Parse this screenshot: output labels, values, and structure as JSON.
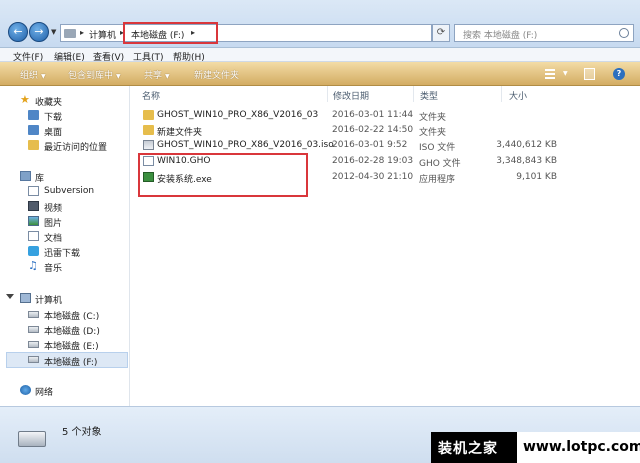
{
  "address": {
    "crumbs": [
      "计算机",
      "本地磁盘 (F:)"
    ],
    "search_placeholder": "搜索 本地磁盘 (F:)"
  },
  "menu": [
    "文件(F)",
    "编辑(E)",
    "查看(V)",
    "工具(T)",
    "帮助(H)"
  ],
  "toolbar": {
    "organize": "组织",
    "include_in_library": "包含到库中",
    "share": "共享",
    "new_folder": "新建文件夹"
  },
  "sidebar": {
    "favorites": {
      "label": "收藏夹",
      "items": [
        "下载",
        "桌面",
        "最近访问的位置"
      ]
    },
    "libraries": {
      "label": "库",
      "items": [
        "Subversion",
        "视频",
        "图片",
        "文档",
        "迅雷下载",
        "音乐"
      ]
    },
    "computer": {
      "label": "计算机",
      "items": [
        "本地磁盘 (C:)",
        "本地磁盘 (D:)",
        "本地磁盘 (E:)",
        "本地磁盘 (F:)"
      ]
    },
    "network": {
      "label": "网络"
    }
  },
  "columns": {
    "name": "名称",
    "date": "修改日期",
    "type": "类型",
    "size": "大小"
  },
  "files": [
    {
      "name": "GHOST_WIN10_PRO_X86_V2016_03",
      "date": "2016-03-01 11:44",
      "type": "文件夹",
      "size": "",
      "icon": "folder-icon"
    },
    {
      "name": "新建文件夹",
      "date": "2016-02-22 14:50",
      "type": "文件夹",
      "size": "",
      "icon": "folder-icon"
    },
    {
      "name": "GHOST_WIN10_PRO_X86_V2016_03.iso",
      "date": "2016-03-01 9:52",
      "type": "ISO 文件",
      "size": "3,440,612 KB",
      "icon": "iso-file-icon"
    },
    {
      "name": "WIN10.GHO",
      "date": "2016-02-28 19:03",
      "type": "GHO 文件",
      "size": "3,348,843 KB",
      "icon": "gho-file-icon"
    },
    {
      "name": "安装系统.exe",
      "date": "2012-04-30 21:10",
      "type": "应用程序",
      "size": "9,101 KB",
      "icon": "exe-file-icon"
    }
  ],
  "status": {
    "text": "5 个对象"
  },
  "watermark": {
    "left": "装机之家",
    "right": "www.lotpc.com"
  },
  "colors": {
    "highlight_box": "#d9363b",
    "toolbar": "#d3ac63"
  }
}
